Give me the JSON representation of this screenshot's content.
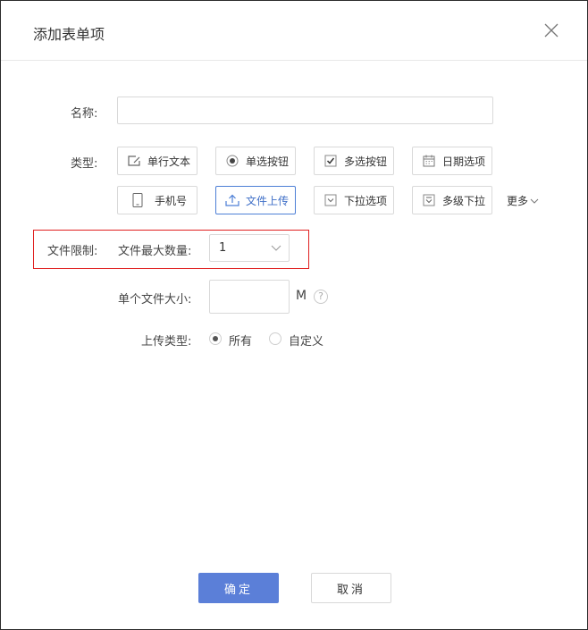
{
  "dialog": {
    "title": "添加表单项"
  },
  "form": {
    "name_label": "名称:",
    "name_value": "",
    "type_label": "类型:",
    "types": [
      {
        "label": "单行文本",
        "icon": "text-edit-icon"
      },
      {
        "label": "单选按钮",
        "icon": "radio-icon"
      },
      {
        "label": "多选按钮",
        "icon": "checkbox-icon"
      },
      {
        "label": "日期选项",
        "icon": "calendar-icon"
      },
      {
        "label": "手机号",
        "icon": "phone-icon"
      },
      {
        "label": "文件上传",
        "icon": "upload-icon",
        "active": true
      },
      {
        "label": "下拉选项",
        "icon": "dropdown-icon"
      },
      {
        "label": "多级下拉",
        "icon": "multilevel-dropdown-icon"
      }
    ],
    "more_label": "更多",
    "file_limit_label": "文件限制:",
    "max_count_label": "文件最大数量:",
    "max_count_value": "1",
    "file_size_label": "单个文件大小:",
    "file_size_value": "",
    "file_size_unit": "M",
    "help_symbol": "?",
    "upload_type_label": "上传类型:",
    "upload_type_options": [
      "所有",
      "自定义"
    ],
    "upload_type_selected": "所有"
  },
  "footer": {
    "confirm_label": "确定",
    "cancel_label": "取消"
  },
  "colors": {
    "primary": "#5b7fd8",
    "active_border": "#4d7fd6",
    "highlight": "#e02020"
  }
}
